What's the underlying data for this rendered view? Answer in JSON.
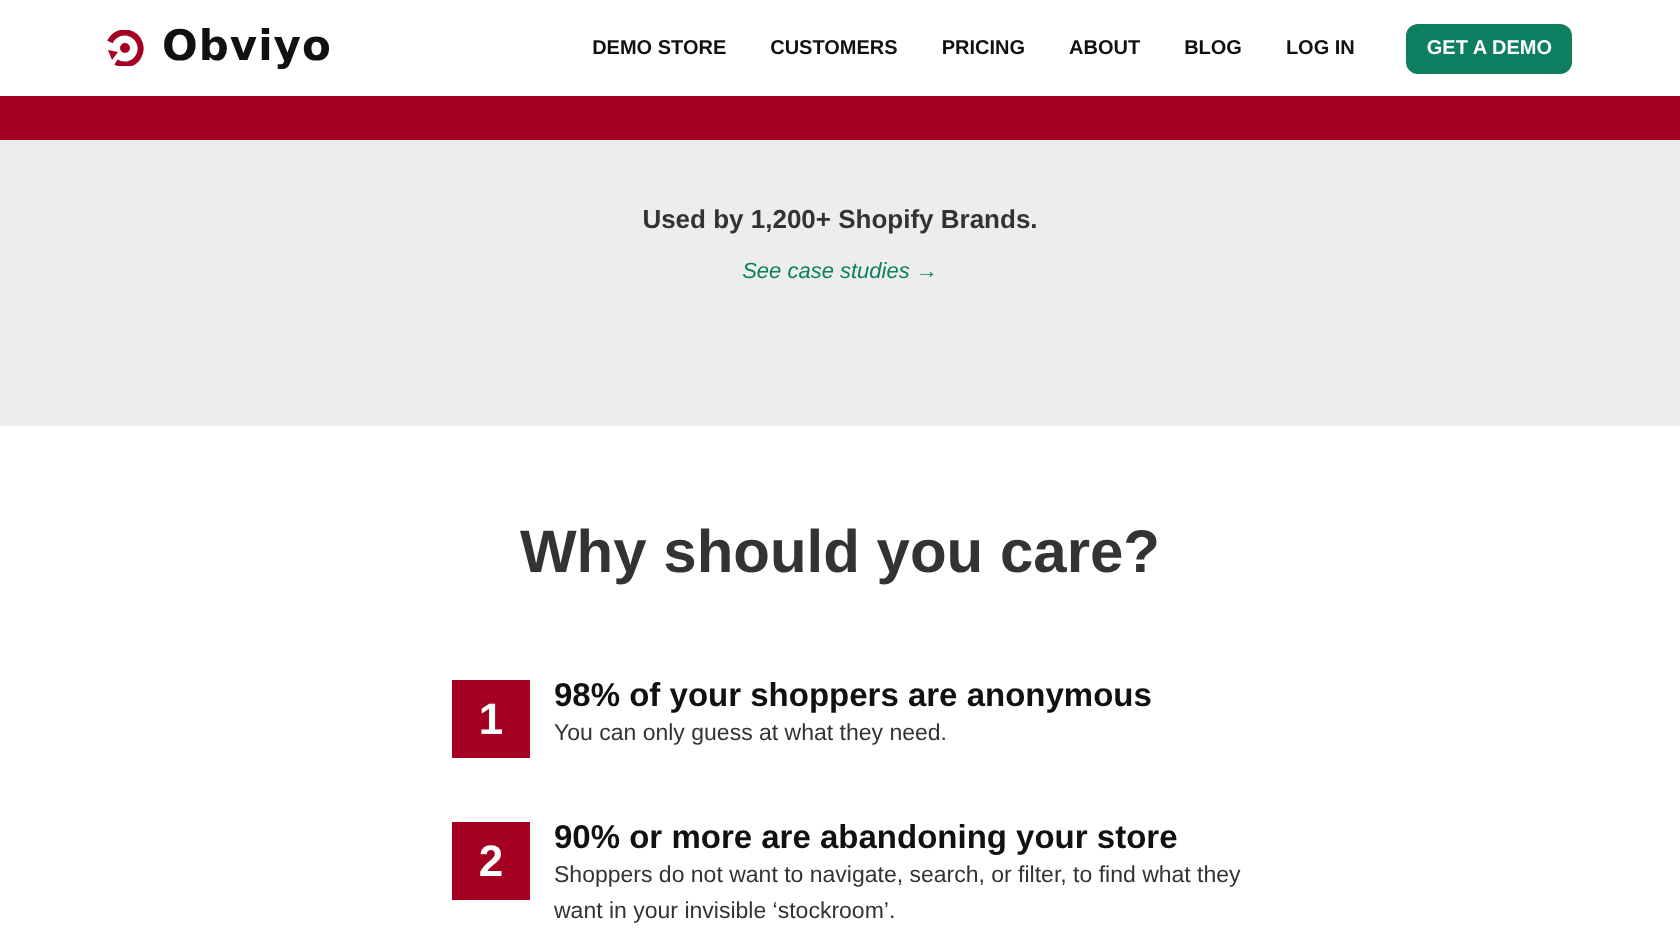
{
  "logo": {
    "text": "Obviyo"
  },
  "nav": {
    "links": [
      "DEMO STORE",
      "CUSTOMERS",
      "PRICING",
      "ABOUT",
      "BLOG",
      "LOG IN"
    ],
    "cta": "GET A DEMO"
  },
  "proof": {
    "text": "Used by 1,200+ Shopify Brands.",
    "link": "See case studies →"
  },
  "reasons": {
    "heading": "Why should you care?",
    "items": [
      {
        "number": "1",
        "title": "98% of your shoppers are anonymous",
        "text": "You can only guess at what they need."
      },
      {
        "number": "2",
        "title": "90% or more are abandoning your store",
        "text": "Shoppers do not want to navigate, search, or filter, to find what they want in your invisible ‘stockroom’."
      }
    ]
  }
}
